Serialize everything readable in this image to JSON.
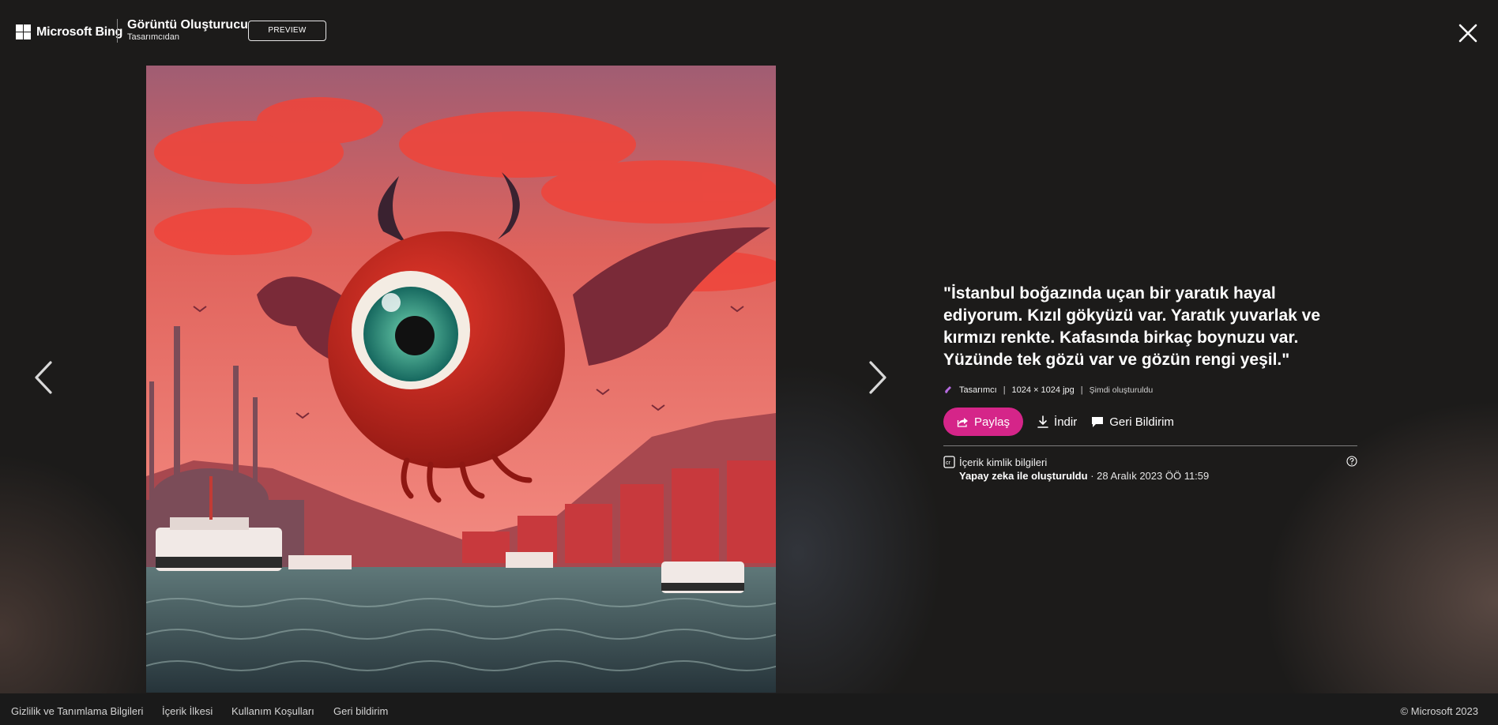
{
  "header": {
    "brand": "Microsoft Bing",
    "app_title": "Görüntü Oluşturucu",
    "app_subtitle": "Tasarımcıdan",
    "badge": "PREVIEW"
  },
  "image": {
    "alt": "İstanbul boğazında uçan tek gözlü kırmızı yaratık"
  },
  "details": {
    "prompt": "\"İstanbul boğazında uçan bir yaratık hayal ediyorum. Kızıl gökyüzü var. Yaratık yuvarlak ve kırmızı renkte. Kafasında birkaç boynuzu var. Yüzünde tek gözü var ve gözün rengi yeşil.\"",
    "source": "Tasarımcı",
    "size": "1024 × 1024 jpg",
    "created": "Şimdi oluşturuldu",
    "separator": "|"
  },
  "actions": {
    "share": "Paylaş",
    "download": "İndir",
    "feedback": "Geri Bildirim"
  },
  "credentials": {
    "title": "İçerik kimlik bilgileri",
    "generated": "Yapay zeka ile oluşturuldu",
    "date": "· 28 Aralık 2023 ÖÖ 11:59"
  },
  "footer": {
    "privacy": "Gizlilik ve Tanımlama Bilgileri",
    "content_policy": "İçerik İlkesi",
    "terms": "Kullanım Koşulları",
    "feedback": "Geri bildirim",
    "copyright": "© Microsoft 2023"
  },
  "colors": {
    "background": "#1c1b1a",
    "share_button": "#d52589",
    "sky": "#e9695f",
    "sea": "#3c4e52",
    "creature": "#c3271e",
    "eye": "#2a9b86"
  },
  "icons": [
    "microsoft-logo-icon",
    "close-icon",
    "chevron-left-icon",
    "chevron-right-icon",
    "designer-icon",
    "share-icon",
    "download-icon",
    "comment-icon",
    "content-credentials-icon",
    "help-icon"
  ]
}
